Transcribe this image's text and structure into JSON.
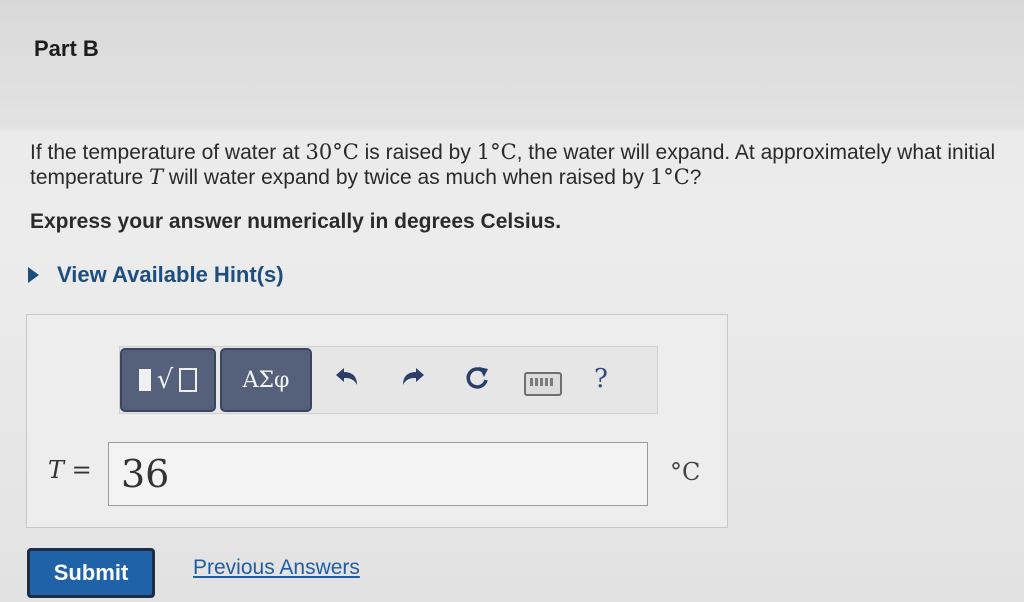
{
  "part": {
    "title": "Part B"
  },
  "question": {
    "t1": "If the temperature of water at ",
    "temp1": "30",
    "deg1": "°",
    "unit1": "C",
    "t2": " is raised by ",
    "temp2": "1",
    "deg2": "°",
    "unit2": "C",
    "t3": ", the water will expand. At approximately what initial temperature ",
    "var": "T",
    "t4": " will water expand by twice as much when raised by ",
    "temp3": "1",
    "deg3": "°",
    "unit3": "C",
    "t5": "?"
  },
  "instruction": "Express your answer numerically in degrees Celsius.",
  "hint": {
    "label": "View Available Hint(s)"
  },
  "toolbar": {
    "greek_label": "ΑΣφ",
    "undo_icon": "undo-arrow-icon",
    "redo_icon": "redo-arrow-icon",
    "reset_icon": "reset-circular-arrow-icon",
    "keyboard_icon": "keyboard-icon",
    "help_label": "?"
  },
  "answer": {
    "variable_label": "T =",
    "value": "36",
    "unit": "°C"
  },
  "actions": {
    "submit_label": "Submit",
    "previous_answers_label": "Previous Answers"
  },
  "colors": {
    "link": "#1f5ea3",
    "toolbar_button": "#55607a",
    "submit": "#1f62a8"
  }
}
